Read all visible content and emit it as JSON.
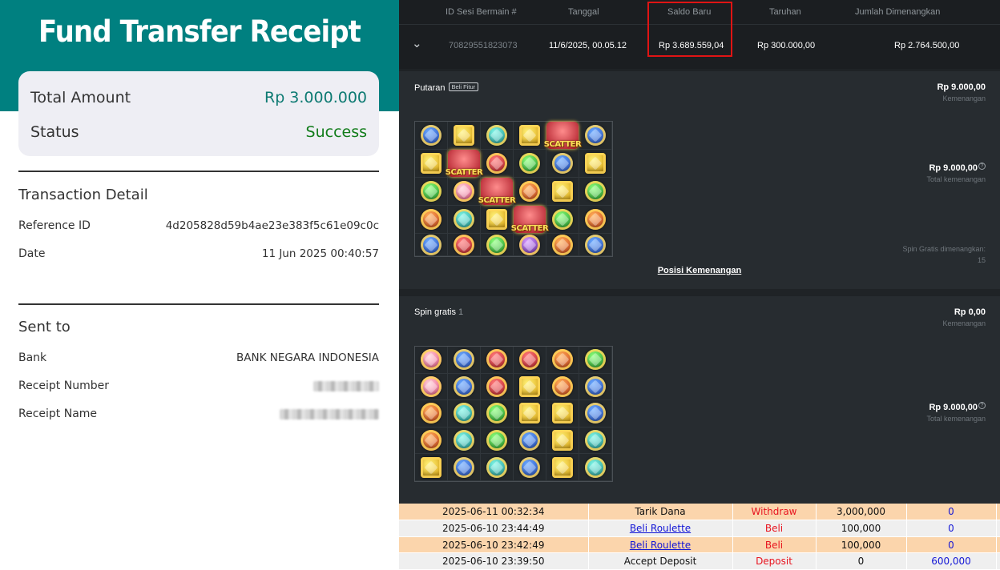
{
  "receipt": {
    "title": "Fund Transfer Receipt",
    "total_amount_label": "Total Amount",
    "total_amount_value": "Rp 3.000.000",
    "status_label": "Status",
    "status_value": "Success",
    "transaction_detail_heading": "Transaction Detail",
    "reference_id_label": "Reference ID",
    "reference_id_value": "4d205828d59b4ae23e383f5c61e09c0c",
    "date_label": "Date",
    "date_value": "11 Jun 2025 00:40:57",
    "sent_to_heading": "Sent to",
    "bank_label": "Bank",
    "bank_value": "BANK NEGARA INDONESIA",
    "receipt_number_label": "Receipt Number",
    "receipt_name_label": "Receipt Name",
    "colors": {
      "teal": "#008080",
      "amount": "#0d7a72",
      "success": "#117c1a"
    }
  },
  "game": {
    "headers": [
      "ID Sesi Bermain #",
      "Tanggal",
      "Saldo Baru",
      "Taruhan",
      "Jumlah Dimenangkan"
    ],
    "session": {
      "id": "70829551823073",
      "date": "11/6/2025, 00.05.12",
      "saldo_baru": "Rp 3.689.559,04",
      "taruhan": "Rp 300.000,00",
      "jumlah_dimenangkan": "Rp 2.764.500,00"
    },
    "putaran": {
      "title": "Putaran",
      "badge": "Beli Fitur",
      "win_amount": "Rp 9.000,00",
      "win_label": "Kemenangan",
      "total_amount": "Rp 9.000,00",
      "total_label": "Total kemenangan",
      "free_spins_label": "Spin Gratis dimenangkan:",
      "free_spins_value": "15",
      "position_link": "Posisi Kemenangan",
      "scatter_text": "SCATTER"
    },
    "spin_gratis": {
      "title": "Spin gratis",
      "count": "1",
      "win_amount": "Rp 0,00",
      "win_label": "Kemenangan",
      "total_amount": "Rp 9.000,00",
      "total_label": "Total kemenangan"
    },
    "help_glyph": "?",
    "chevron_glyph": "⌄"
  },
  "transactions": [
    {
      "datetime": "2025-06-11 00:32:34",
      "description": "Tarik Dana",
      "type": "Withdraw",
      "amount": "3,000,000",
      "credit": "0"
    },
    {
      "datetime": "2025-06-10 23:44:49",
      "description": "Beli Roulette",
      "type": "Beli",
      "amount": "100,000",
      "credit": "0"
    },
    {
      "datetime": "2025-06-10 23:42:49",
      "description": "Beli Roulette",
      "type": "Beli",
      "amount": "100,000",
      "credit": "0"
    },
    {
      "datetime": "2025-06-10 23:39:50",
      "description": "Accept Deposit",
      "type": "Deposit",
      "amount": "0",
      "credit": "600,000"
    }
  ]
}
